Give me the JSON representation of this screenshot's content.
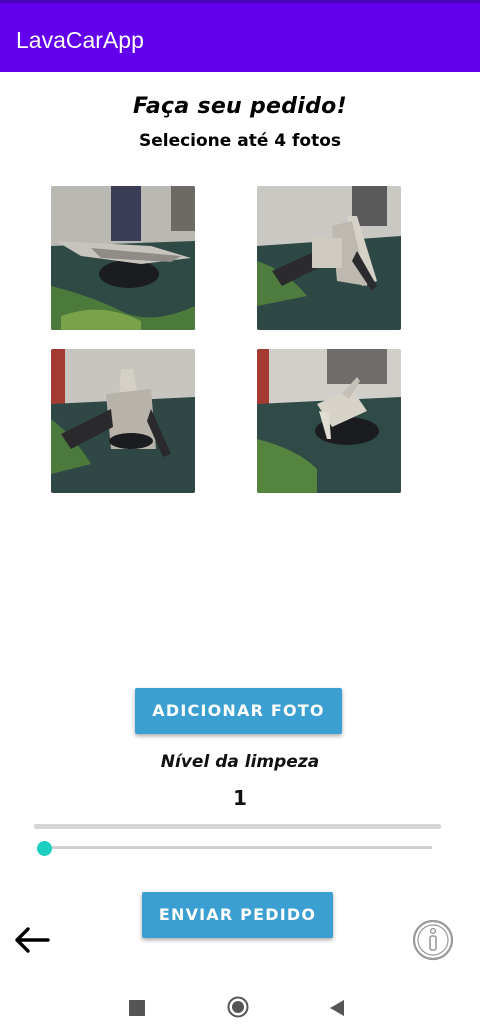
{
  "app": {
    "title": "LavaCarApp"
  },
  "order": {
    "heading": "Faça seu pedido!",
    "subheading": "Selecione até 4 fotos",
    "photos": [
      "ship-photo",
      "ship-photo",
      "ship-photo",
      "ship-photo"
    ],
    "add_photo_label": "ADICIONAR FOTO",
    "cleaning_level_label": "Nível da limpeza",
    "cleaning_level_value": "1",
    "progress_fraction": 0.0,
    "slider_fraction": 0.0,
    "send_label": "ENVIAR PEDIDO"
  },
  "colors": {
    "appbar": "#6200EE",
    "button": "#3b9fd1",
    "slider_accent": "#1ccfbf"
  },
  "icons": {
    "back": "arrow-left-icon",
    "info": "info-icon",
    "nav_recents": "square-icon",
    "nav_home": "circle-icon",
    "nav_back": "triangle-icon"
  }
}
